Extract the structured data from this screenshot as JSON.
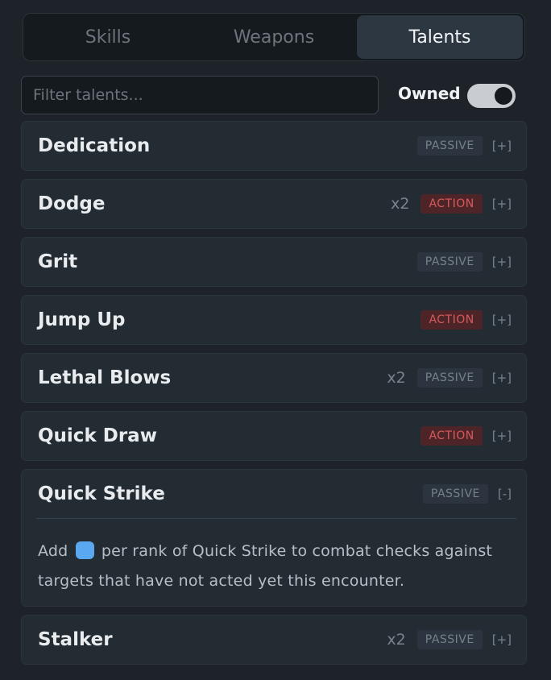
{
  "tabs": [
    {
      "label": "Skills",
      "active": false
    },
    {
      "label": "Weapons",
      "active": false
    },
    {
      "label": "Talents",
      "active": true
    }
  ],
  "filter": {
    "placeholder": "Filter talents...",
    "value": ""
  },
  "owned_toggle": {
    "label": "Owned",
    "on": true
  },
  "talents": [
    {
      "name": "Dedication",
      "rank": "",
      "type": "PASSIVE",
      "toggle": "[+]"
    },
    {
      "name": "Dodge",
      "rank": "x2",
      "type": "ACTION",
      "toggle": "[+]"
    },
    {
      "name": "Grit",
      "rank": "",
      "type": "PASSIVE",
      "toggle": "[+]"
    },
    {
      "name": "Jump Up",
      "rank": "",
      "type": "ACTION",
      "toggle": "[+]"
    },
    {
      "name": "Lethal Blows",
      "rank": "x2",
      "type": "PASSIVE",
      "toggle": "[+]"
    },
    {
      "name": "Quick Draw",
      "rank": "",
      "type": "ACTION",
      "toggle": "[+]"
    },
    {
      "name": "Quick Strike",
      "rank": "",
      "type": "PASSIVE",
      "toggle": "[-]",
      "expanded": true,
      "desc_before": "Add",
      "desc_icon": "boost-die-icon",
      "desc_after": "per rank of Quick Strike to combat checks against targets that have not acted yet this encounter."
    },
    {
      "name": "Stalker",
      "rank": "x2",
      "type": "PASSIVE",
      "toggle": "[+]"
    }
  ],
  "colors": {
    "background": "#1d2329",
    "card": "#232b33",
    "passive_badge": "#2c353f",
    "action_badge": "#4d2529",
    "action_text": "#d65a5a",
    "boost_die": "#5aa8f0"
  }
}
